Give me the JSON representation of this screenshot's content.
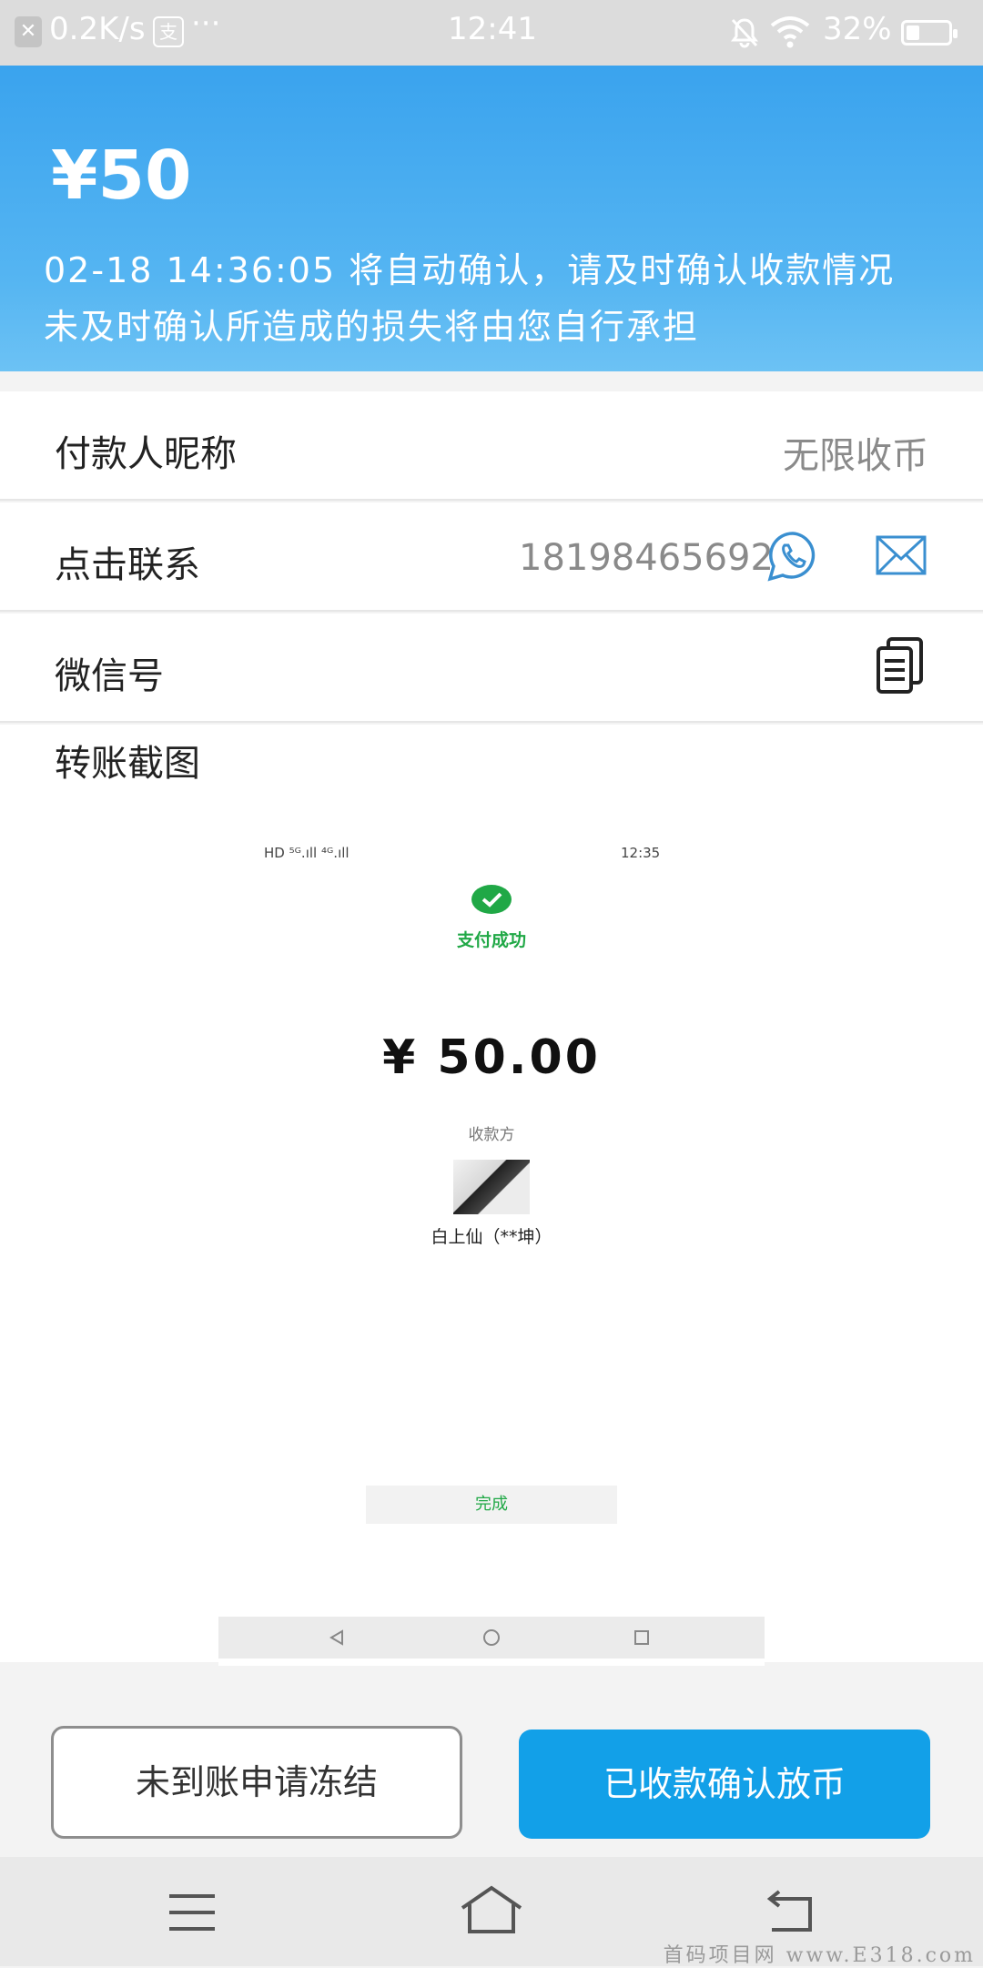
{
  "status_bar": {
    "net_speed": "0.2K/s",
    "alipay_glyph": "支",
    "more": "···",
    "time": "12:41",
    "battery": "32%",
    "icons": [
      "close-icon",
      "alipay-icon",
      "dnd-bell-icon",
      "wifi-icon",
      "battery-icon"
    ]
  },
  "header": {
    "amount": "¥50",
    "notice_line1": "02-18 14:36:05 将自动确认，请及时确认收款情况",
    "notice_line2": "未及时确认所造成的损失将由您自行承担",
    "colors": {
      "top": "#3aa3ee",
      "bottom": "#6cc2f4"
    }
  },
  "details": {
    "payer_label": "付款人昵称",
    "payer_value": "无限收币",
    "contact_label": "点击联系",
    "contact_phone": "18198465692",
    "wechat_label": "微信号",
    "screenshot_label": "转账截图",
    "icons": [
      "phone-icon",
      "mail-icon",
      "copy-icon"
    ]
  },
  "transfer_screenshot": {
    "status_left": "HD ⁵ᴳ.ıll ⁴ᴳ.ıll",
    "status_time": "12:35",
    "title": "支付成功",
    "amount": "¥ 50.00",
    "payee_label": "收款方",
    "payee_name": "白上仙（**坤）",
    "done": "完成",
    "accent": "#20a846"
  },
  "actions": {
    "freeze": "未到账申请冻结",
    "confirm": "已收款确认放币",
    "confirm_color": "#12a0e8"
  },
  "system_nav": {
    "icons": [
      "menu-icon",
      "home-icon",
      "back-icon"
    ]
  },
  "watermark": "首码项目网 www.E318.com"
}
